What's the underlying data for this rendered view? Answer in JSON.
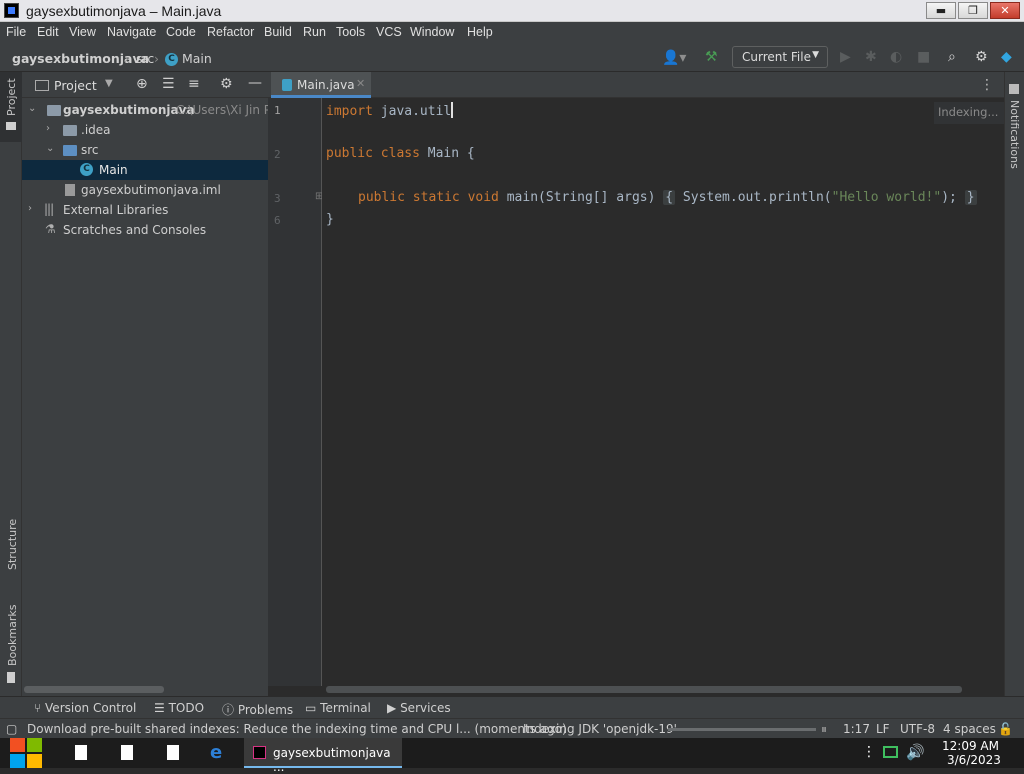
{
  "window": {
    "title": "gaysexbutimonjava – Main.java",
    "min": "▬",
    "max": "❐",
    "close": "✕"
  },
  "menu": [
    "File",
    "Edit",
    "View",
    "Navigate",
    "Code",
    "Refactor",
    "Build",
    "Run",
    "Tools",
    "VCS",
    "Window",
    "Help"
  ],
  "breadcrumb": {
    "project": "gaysexbutimonjava",
    "folder": "src",
    "file": "Main"
  },
  "toolbar": {
    "run_config": "Current File"
  },
  "project_panel": {
    "title": "Project",
    "tree": [
      {
        "label": "gaysexbutimonjava",
        "path": "C:\\Users\\Xi Jin Pin"
      },
      {
        "label": ".idea"
      },
      {
        "label": "src"
      },
      {
        "label": "Main"
      },
      {
        "label": "gaysexbutimonjava.iml"
      },
      {
        "label": "External Libraries"
      },
      {
        "label": "Scratches and Consoles"
      }
    ]
  },
  "side_tabs": {
    "project": "Project",
    "structure": "Structure",
    "bookmarks": "Bookmarks",
    "notifications": "Notifications"
  },
  "editor": {
    "tab": "Main.java",
    "indexing": "Indexing...",
    "line_numbers": [
      "1",
      "2",
      "3",
      "6"
    ],
    "code": {
      "line1_kw": "import",
      "line1_rest": " java.util",
      "line2_kw": "public class",
      "line2_rest": " Main {",
      "line3_kw": "public static void",
      "line3_mid": " main(String[] args)",
      "line3_body_a": " System.out.println(",
      "line3_str": "\"Hello world!\"",
      "line3_body_b": ");",
      "line6": "}"
    }
  },
  "bottom_tools": [
    "Version Control",
    "TODO",
    "Problems",
    "Terminal",
    "Services"
  ],
  "status": {
    "message": "Download pre-built shared indexes: Reduce the indexing time and CPU l... (moments ago)",
    "indexing": "Indexing JDK 'openjdk-19'",
    "position": "1:17",
    "line_sep": "LF",
    "encoding": "UTF-8",
    "indent": "4 spaces"
  },
  "taskbar": {
    "app": "gaysexbutimonjava ...",
    "time": "12:09 AM",
    "date": "3/6/2023"
  },
  "colors": {
    "accent": "#4a88c7",
    "keyword": "#cc7832",
    "string": "#6a8759"
  }
}
